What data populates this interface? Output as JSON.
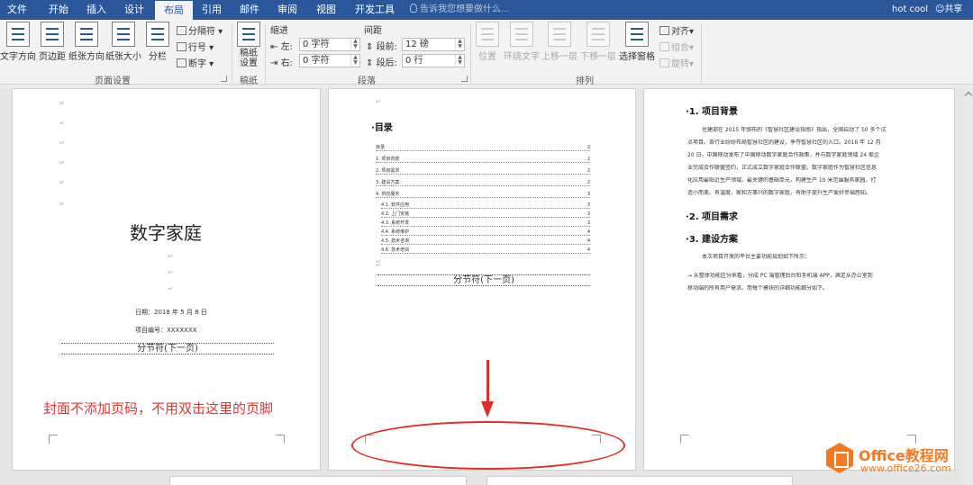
{
  "tabs": [
    "文件",
    "开始",
    "插入",
    "设计",
    "布局",
    "引用",
    "邮件",
    "审阅",
    "视图",
    "开发工具"
  ],
  "active_tab": "布局",
  "tell_me": "告诉我您想要做什么...",
  "user": "hot cool",
  "share": "共享",
  "ribbon": {
    "page_setup": {
      "text_direction": "文字方向",
      "margins": "页边距",
      "orientation": "纸张方向",
      "size": "纸张大小",
      "columns": "分栏",
      "breaks": "分隔符",
      "line_numbers": "行号",
      "hyphenation": "断字",
      "group": "页面设置"
    },
    "draft": {
      "setup": "稿纸设置",
      "group": "稿纸"
    },
    "paragraph": {
      "indent": "缩进",
      "spacing": "间距",
      "left": "左:",
      "right": "右:",
      "left_value": "0 字符",
      "right_value": "0 字符",
      "before": "段前:",
      "after": "段后:",
      "before_value": "12 磅",
      "after_value": "0 行",
      "group": "段落"
    },
    "arrange": {
      "position": "位置",
      "wrap": "环绕文字",
      "forward": "上移一层",
      "backward": "下移一层",
      "pane": "选择窗格",
      "align": "对齐",
      "group_btn": "组合",
      "rotate": "旋转",
      "group": "排列"
    }
  },
  "page1": {
    "title": "数字家庭",
    "date": "日期：2018 年 5 月 8 日",
    "number": "项目编号：XXXXXXX",
    "section_break": "分节符(下一页)",
    "annotation": "封面不添加页码，不用双击这里的页脚"
  },
  "page2": {
    "toc_title": "目录",
    "toc": [
      {
        "label": "目录",
        "page": "2"
      },
      {
        "label": "1. 项目背景",
        "page": "2"
      },
      {
        "label": "2. 项目需求",
        "page": "2"
      },
      {
        "label": "3. 建设方案",
        "page": "2"
      },
      {
        "label": "4. 供应服务",
        "page": "3"
      },
      {
        "label": "4.1. 软件应用",
        "page": "3"
      },
      {
        "label": "4.2. 上门安装",
        "page": "3"
      },
      {
        "label": "4.3. 系统开发",
        "page": "3"
      },
      {
        "label": "4.4. 系统维护",
        "page": "4"
      },
      {
        "label": "4.5. 技术咨询",
        "page": "4"
      },
      {
        "label": "4.6. 技术培训",
        "page": "4"
      }
    ],
    "section_break": "分节符(下一页)"
  },
  "page3": {
    "h1": "1. 项目背景",
    "p1": [
      "住建部在 2015 年颁布的《智慧社区建设指南》指出，全国启动了 50 多个试",
      "点项目。各行业纷纷布局智慧社区的建设，争夺智慧社区的入口。2016 年 12 月",
      "20 日，中国移动发布了中国移动数字家庭合作政策，并与数字家庭领域 24 家企",
      "业完成合作联盟签约，正式成立数字家庭合作联盟。数字家庭作为智慧社区信息",
      "化应用最贴近生产领域、最关键的基础单元，构建生产 10 米范围服务家园，打",
      "造小而美、有温度、家和万事兴的数字家庭，有助于提升生产爱好幸福感知。"
    ],
    "h2": "2. 项目需求",
    "h3": "3. 建设方案",
    "p3": [
      "本次项目开发的平台主要功能规划如下所示：",
      "→ 从整体功能区分来看，分成 PC 端管理后台和手机端 APP，满足从办公室到",
      "移动端的所有用户需求。而每个模块的详细功能细分如下。"
    ]
  },
  "watermark": {
    "brand": "Office教程网",
    "url": "www.office26.com"
  }
}
